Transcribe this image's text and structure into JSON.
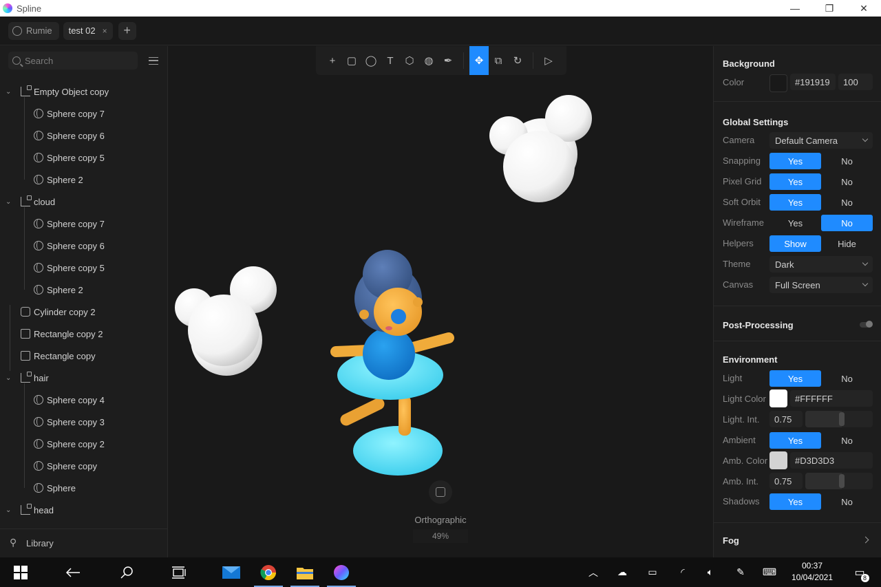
{
  "app": {
    "title": "Spline"
  },
  "window_controls": {
    "minimize": "—",
    "maximize": "❐",
    "close": "✕"
  },
  "tabs": {
    "user": "Rumie",
    "document": "test 02",
    "close": "×",
    "add": "+"
  },
  "sidebar": {
    "search_placeholder": "Search",
    "items": [
      {
        "label": "Empty Object copy",
        "icon": "group-icon",
        "level": 0,
        "expanded": true
      },
      {
        "label": "Sphere copy 7",
        "icon": "sphere-icon",
        "level": 1
      },
      {
        "label": "Sphere copy 6",
        "icon": "sphere-icon",
        "level": 1
      },
      {
        "label": "Sphere copy 5",
        "icon": "sphere-icon",
        "level": 1
      },
      {
        "label": "Sphere 2",
        "icon": "sphere-icon",
        "level": 1
      },
      {
        "label": "cloud",
        "icon": "group-icon",
        "level": 0,
        "expanded": true
      },
      {
        "label": "Sphere copy 7",
        "icon": "sphere-icon",
        "level": 1
      },
      {
        "label": "Sphere copy 6",
        "icon": "sphere-icon",
        "level": 1
      },
      {
        "label": "Sphere copy 5",
        "icon": "sphere-icon",
        "level": 1
      },
      {
        "label": "Sphere 2",
        "icon": "sphere-icon",
        "level": 1
      },
      {
        "label": "Cylinder copy 2",
        "icon": "cylinder-icon",
        "level": 0
      },
      {
        "label": "Rectangle copy 2",
        "icon": "rectangle-icon",
        "level": 0
      },
      {
        "label": "Rectangle copy",
        "icon": "rectangle-icon",
        "level": 0
      },
      {
        "label": "hair",
        "icon": "group-icon",
        "level": 0,
        "expanded": true
      },
      {
        "label": "Sphere copy 4",
        "icon": "sphere-icon",
        "level": 1
      },
      {
        "label": "Sphere copy 3",
        "icon": "sphere-icon",
        "level": 1
      },
      {
        "label": "Sphere copy 2",
        "icon": "sphere-icon",
        "level": 1
      },
      {
        "label": "Sphere copy",
        "icon": "sphere-icon",
        "level": 1
      },
      {
        "label": "Sphere",
        "icon": "sphere-icon",
        "level": 1
      },
      {
        "label": "head",
        "icon": "group-icon",
        "level": 0,
        "expanded": true
      }
    ],
    "library_label": "Library"
  },
  "toolbar": {
    "tools": [
      {
        "name": "add-icon",
        "glyph": "+"
      },
      {
        "name": "rectangle-tool-icon",
        "glyph": "▢"
      },
      {
        "name": "ellipse-tool-icon",
        "glyph": "◯"
      },
      {
        "name": "text-tool-icon",
        "glyph": "T"
      },
      {
        "name": "cube-tool-icon",
        "glyph": "⬡"
      },
      {
        "name": "sphere-tool-icon",
        "glyph": "◍"
      },
      {
        "name": "pen-tool-icon",
        "glyph": "✒"
      },
      {
        "name": "move-tool-icon",
        "glyph": "✥",
        "active": true
      },
      {
        "name": "scale-tool-icon",
        "glyph": "⧉"
      },
      {
        "name": "rotate-tool-icon",
        "glyph": "↻"
      },
      {
        "name": "play-icon",
        "glyph": "▷"
      }
    ]
  },
  "viewport": {
    "camera_mode": "Orthographic",
    "zoom": "49%"
  },
  "properties": {
    "background": {
      "title": "Background",
      "color_label": "Color",
      "color_hex": "#191919",
      "opacity": "100"
    },
    "global": {
      "title": "Global Settings",
      "camera_label": "Camera",
      "camera_value": "Default Camera",
      "snapping_label": "Snapping",
      "pixel_grid_label": "Pixel Grid",
      "soft_orbit_label": "Soft Orbit",
      "wireframe_label": "Wireframe",
      "helpers_label": "Helpers",
      "theme_label": "Theme",
      "theme_value": "Dark",
      "canvas_label": "Canvas",
      "canvas_value": "Full Screen",
      "yes": "Yes",
      "no": "No",
      "show": "Show",
      "hide": "Hide"
    },
    "post_processing": {
      "title": "Post-Processing"
    },
    "environment": {
      "title": "Environment",
      "light_label": "Light",
      "light_color_label": "Light Color",
      "light_color_hex": "#FFFFFF",
      "light_int_label": "Light. Int.",
      "light_int_value": "0.75",
      "ambient_label": "Ambient",
      "amb_color_label": "Amb. Color",
      "amb_color_hex": "#D3D3D3",
      "amb_int_label": "Amb. Int.",
      "amb_int_value": "0.75",
      "shadows_label": "Shadows"
    },
    "fog": {
      "title": "Fog"
    }
  },
  "taskbar": {
    "time": "00:37",
    "date": "10/04/2021",
    "notifications": "8"
  },
  "colors": {
    "accent": "#1f8bff",
    "panel": "#1d1d1d",
    "canvas": "#191919"
  }
}
